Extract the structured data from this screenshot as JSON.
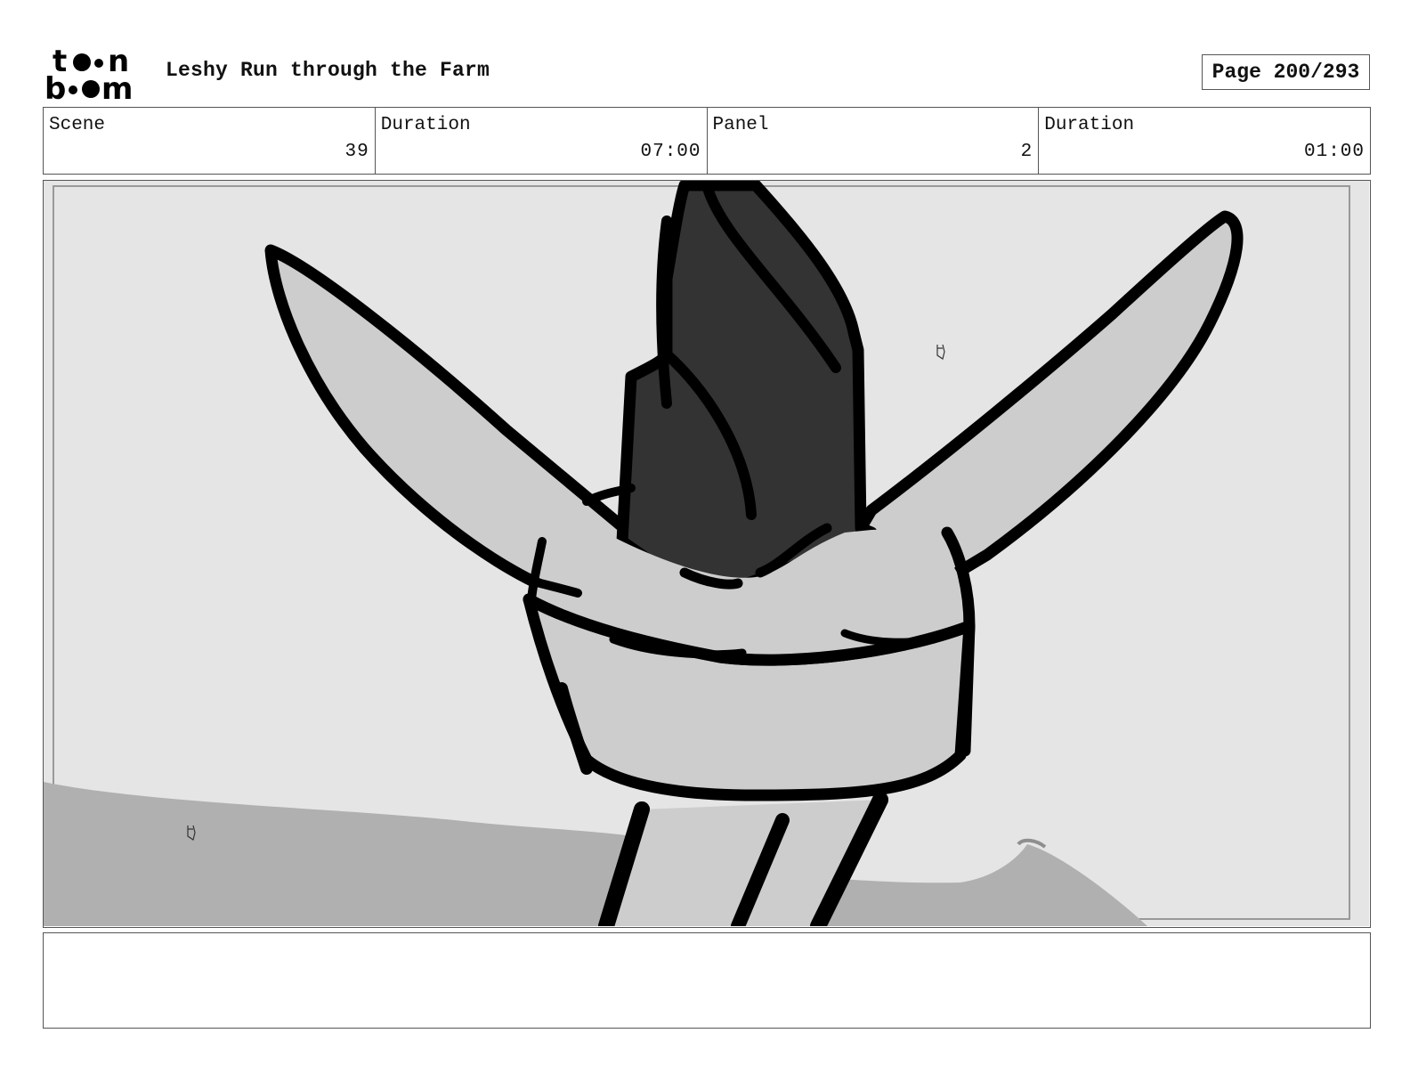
{
  "header": {
    "logo_text": "toon boom",
    "title": "Leshy Run through the Farm",
    "page_label": "Page 200/293"
  },
  "info": {
    "scene_label": "Scene",
    "scene_value": "39",
    "scene_duration_label": "Duration",
    "scene_duration_value": "07:00",
    "panel_label": "Panel",
    "panel_value": "2",
    "panel_duration_label": "Duration",
    "panel_duration_value": "01:00"
  },
  "notes": {
    "text": ""
  },
  "colors": {
    "sky": "#e5e5e5",
    "ground": "#b0b0b0",
    "light_fill": "#cdcdcd",
    "dark_fill": "#333333",
    "ink": "#000000",
    "border": "#555555"
  }
}
